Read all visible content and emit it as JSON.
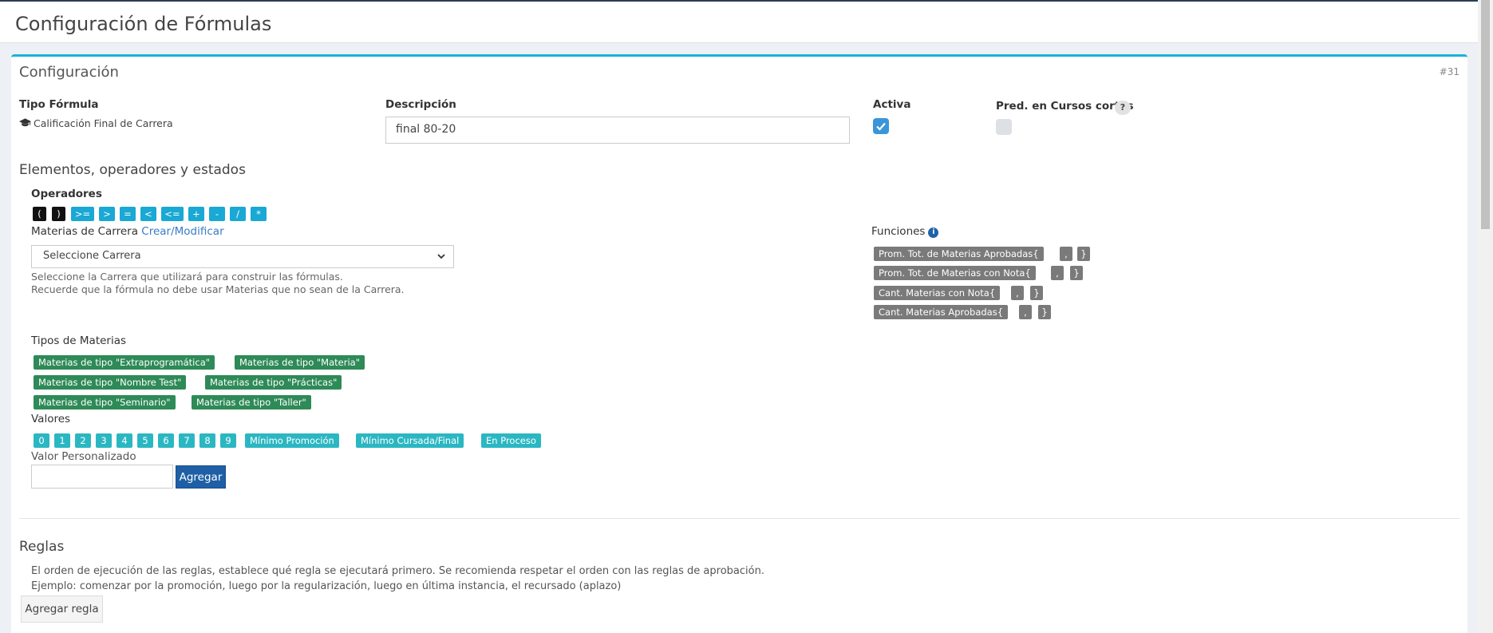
{
  "page": {
    "title": "Configuración de Fórmulas"
  },
  "panel": {
    "title": "Configuración",
    "id_badge": "#31"
  },
  "tipo_formula": {
    "label": "Tipo Fórmula",
    "value": "Calificación Final de Carrera",
    "icon": "graduation-cap-icon"
  },
  "descripcion": {
    "label": "Descripción",
    "value": "final 80-20"
  },
  "activa": {
    "label": "Activa",
    "checked": true
  },
  "pred_cursos": {
    "label": "Pred. en Cursos cortos",
    "help": "?",
    "checked": false
  },
  "elementos": {
    "title": "Elementos, operadores y estados",
    "operadores_label": "Operadores",
    "operadores": [
      "(",
      ")",
      ">=",
      ">",
      "=",
      "<",
      "<=",
      "+",
      "-",
      "/",
      "*"
    ]
  },
  "materias": {
    "label": "Materias de Carrera",
    "link": "Crear/Modificar",
    "select_value": "Seleccione Carrera",
    "help_line1": "Seleccione la Carrera que utilizará para construir las fórmulas.",
    "help_line2": "Recuerde que la fórmula no debe usar Materias que no sean de la Carrera."
  },
  "funciones": {
    "label": "Funciones",
    "info": "i",
    "rows": [
      {
        "name": "Prom. Tot. de Materias Aprobadas{",
        "sep": ",",
        "close": "}"
      },
      {
        "name": "Prom. Tot. de Materias con Nota{",
        "sep": ",",
        "close": "}"
      },
      {
        "name": "Cant. Materias con Nota{",
        "sep": ",",
        "close": "}"
      },
      {
        "name": "Cant. Materias Aprobadas{",
        "sep": ",",
        "close": "}"
      }
    ]
  },
  "tipos": {
    "label": "Tipos de Materias",
    "items": [
      "Materias de tipo \"Extraprogramática\"",
      "Materias de tipo \"Materia\"",
      "Materias de tipo \"Nombre Test\"",
      "Materias de tipo \"Prácticas\"",
      "Materias de tipo \"Seminario\"",
      "Materias de tipo \"Taller\""
    ]
  },
  "valores": {
    "label": "Valores",
    "digits": [
      "0",
      "1",
      "2",
      "3",
      "4",
      "5",
      "6",
      "7",
      "8",
      "9"
    ],
    "especiales": [
      "Mínimo Promoción",
      "Mínimo Cursada/Final",
      "En Proceso"
    ],
    "custom_label": "Valor Personalizado",
    "custom_value": "",
    "add_button": "Agregar"
  },
  "reglas": {
    "title": "Reglas",
    "line1": "El orden de ejecución de las reglas, establece qué regla se ejecutará primero. Se recomienda respetar el orden con las reglas de aprobación.",
    "line2": "Ejemplo: comenzar por la promoción, luego por la regularización, luego en última instancia, el recursado (aplazo)",
    "add_button": "Agregar regla"
  },
  "colors": {
    "accent": "#1ab2d8",
    "checkbox": "#3b95d9",
    "operator": "#1aa8d4",
    "function": "#7a7a7a",
    "tipo": "#2e8a57",
    "valor": "#2bb7c2",
    "primary_button": "#1e5fa5"
  }
}
